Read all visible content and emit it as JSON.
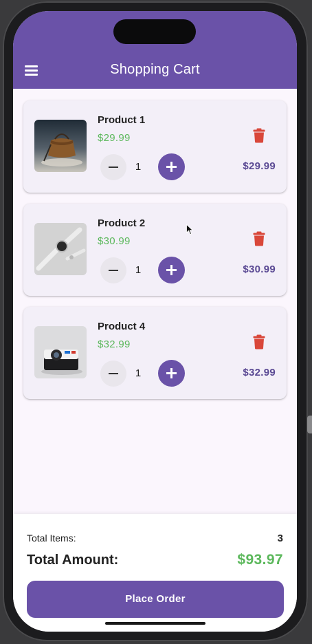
{
  "app_bar": {
    "title": "Shopping Cart",
    "menu_icon": "hamburger-menu-icon",
    "background": "#6a52a8"
  },
  "cart": {
    "items": [
      {
        "name": "Product 1",
        "price": "$29.99",
        "quantity": "1",
        "line_total": "$29.99",
        "image": "leather-bag-photo"
      },
      {
        "name": "Product 2",
        "price": "$30.99",
        "quantity": "1",
        "line_total": "$30.99",
        "image": "smartwatch-photo"
      },
      {
        "name": "Product 4",
        "price": "$32.99",
        "quantity": "1",
        "line_total": "$32.99",
        "image": "instant-camera-photo"
      }
    ]
  },
  "summary": {
    "total_items_label": "Total Items:",
    "total_items_value": "3",
    "total_amount_label": "Total Amount:",
    "total_amount_value": "$93.97",
    "place_order_label": "Place Order"
  },
  "colors": {
    "accent": "#6a52a8",
    "price_green": "#5cb85c",
    "delete_red": "#d9473a",
    "line_total": "#5b4a94"
  }
}
